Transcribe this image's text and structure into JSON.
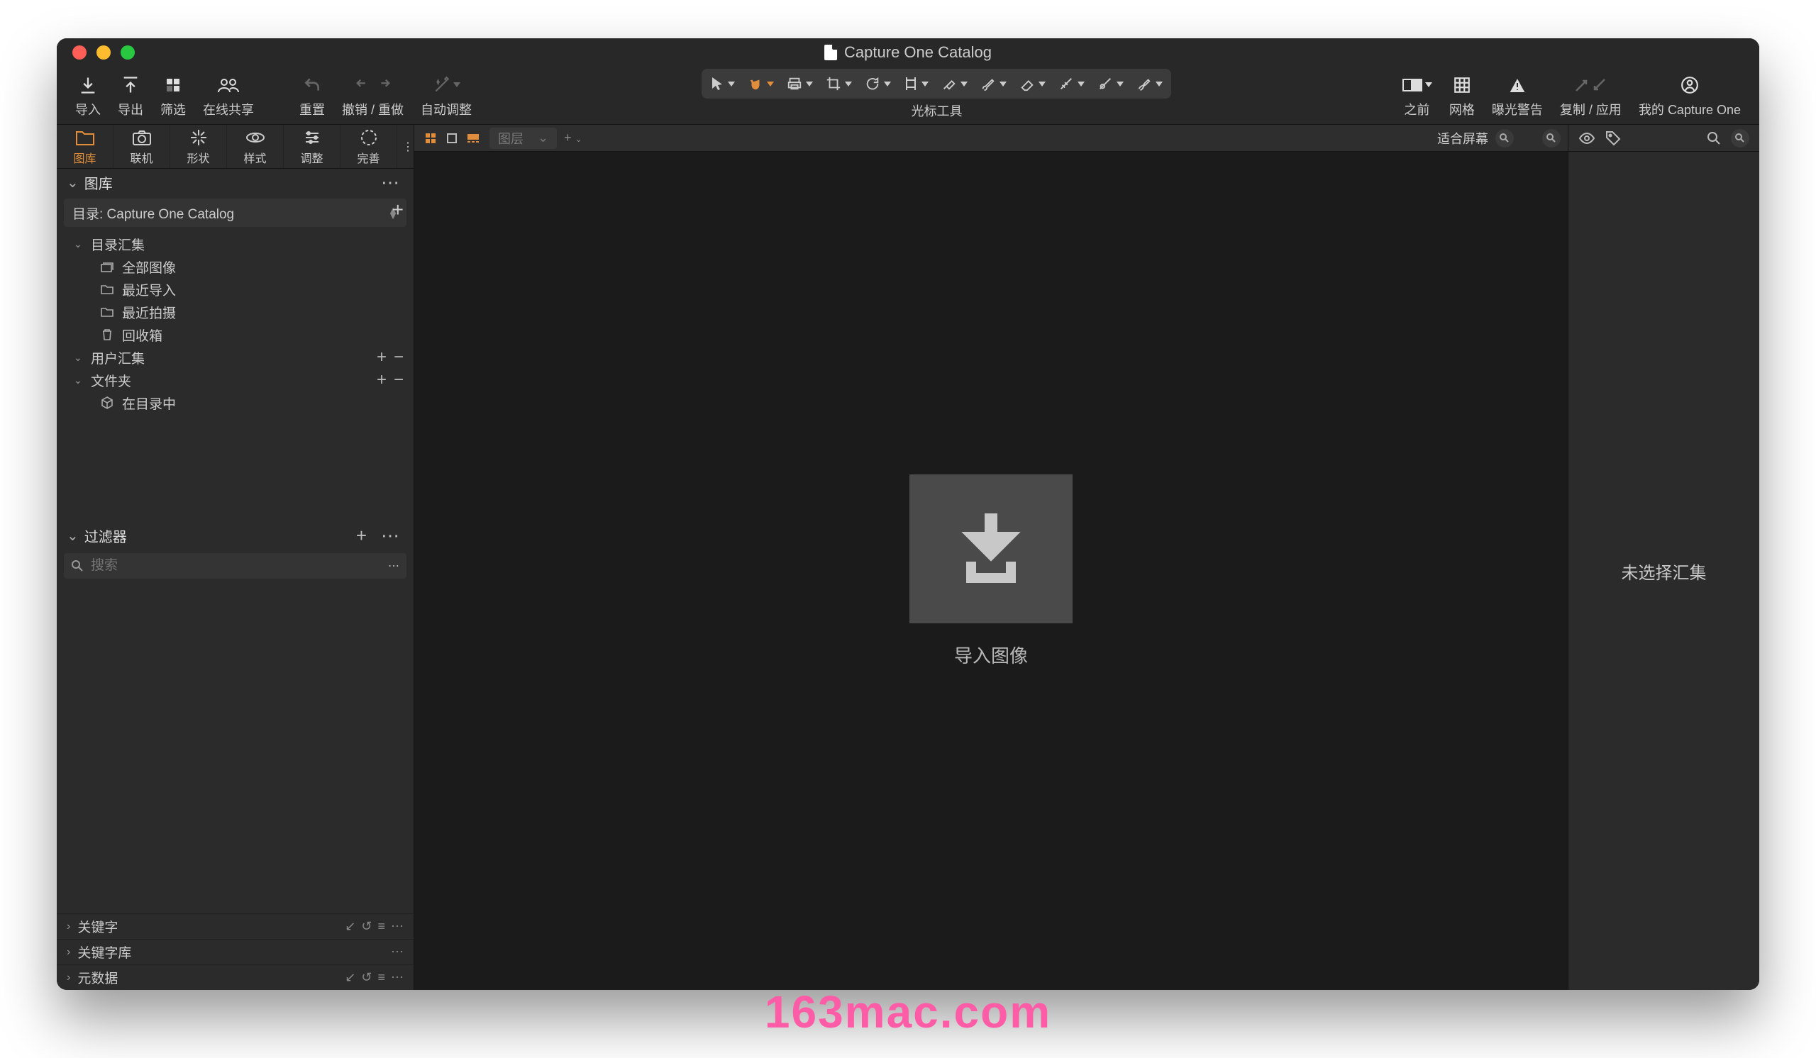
{
  "window": {
    "title": "Capture One Catalog"
  },
  "toolbar": {
    "left": [
      {
        "id": "import",
        "label": "导入"
      },
      {
        "id": "export",
        "label": "导出"
      },
      {
        "id": "filter",
        "label": "筛选"
      },
      {
        "id": "share",
        "label": "在线共享"
      }
    ],
    "undo": [
      {
        "id": "reset",
        "label": "重置"
      },
      {
        "id": "undoredo",
        "label": "撤销 / 重做"
      },
      {
        "id": "autoadj",
        "label": "自动调整"
      }
    ],
    "cursor_label": "光标工具",
    "right": [
      {
        "id": "before",
        "label": "之前"
      },
      {
        "id": "grid",
        "label": "网格"
      },
      {
        "id": "exposure",
        "label": "曝光警告"
      },
      {
        "id": "copyapply",
        "label": "复制 / 应用"
      },
      {
        "id": "account",
        "label": "我的 Capture One"
      }
    ]
  },
  "tooltabs": [
    {
      "id": "library",
      "label": "图库"
    },
    {
      "id": "tether",
      "label": "联机"
    },
    {
      "id": "shape",
      "label": "形状"
    },
    {
      "id": "style",
      "label": "样式"
    },
    {
      "id": "adjust",
      "label": "调整"
    },
    {
      "id": "refine",
      "label": "完善"
    }
  ],
  "library": {
    "panel_title": "图库",
    "catalog_label": "目录: Capture One Catalog",
    "catalog_collections": {
      "title": "目录汇集",
      "items": [
        {
          "icon": "stack",
          "label": "全部图像"
        },
        {
          "icon": "folder",
          "label": "最近导入"
        },
        {
          "icon": "folder",
          "label": "最近拍摄"
        },
        {
          "icon": "trash",
          "label": "回收箱"
        }
      ]
    },
    "user_collections": {
      "title": "用户汇集"
    },
    "folders": {
      "title": "文件夹",
      "items": [
        {
          "icon": "cube",
          "label": "在目录中"
        }
      ]
    }
  },
  "filter": {
    "title": "过滤器",
    "placeholder": "搜索"
  },
  "collapsed": [
    {
      "title": "关键字",
      "mini": true
    },
    {
      "title": "关键字库",
      "mini": false
    },
    {
      "title": "元数据",
      "mini": true
    }
  ],
  "centerbar": {
    "layer_label": "图层",
    "zoom_label": "适合屏幕"
  },
  "canvas": {
    "import_label": "导入图像"
  },
  "rightpanel": {
    "empty_label": "未选择汇集"
  },
  "watermark": "163mac.com"
}
